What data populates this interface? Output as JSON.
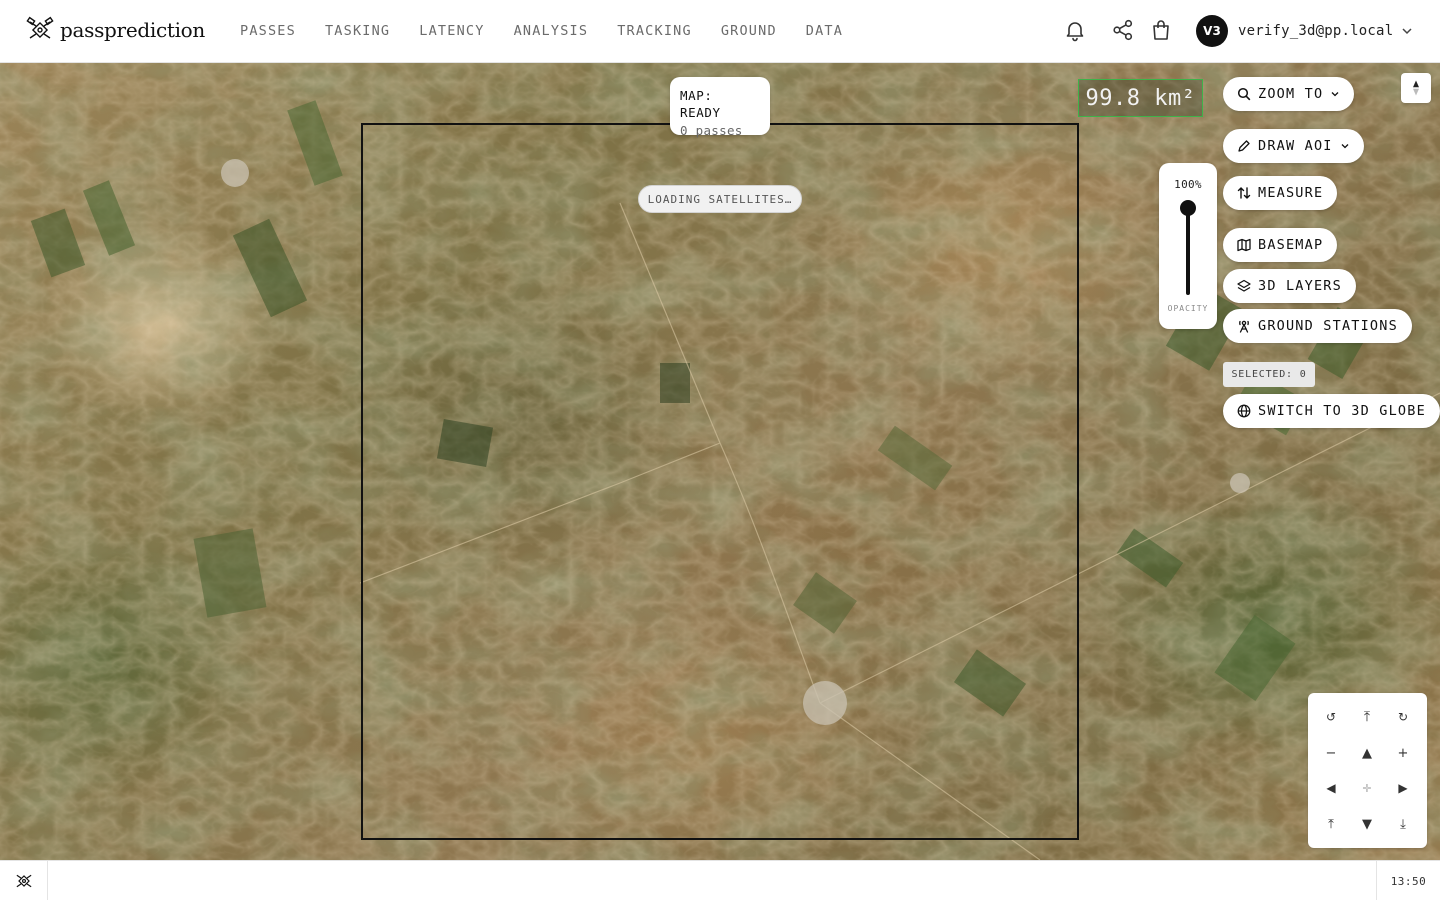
{
  "app": {
    "name": "passprediction",
    "logo_icon": "satellite-logo-icon"
  },
  "header": {
    "nav": [
      {
        "label": "PASSES"
      },
      {
        "label": "TASKING"
      },
      {
        "label": "LATENCY"
      },
      {
        "label": "ANALYSIS"
      },
      {
        "label": "TRACKING"
      },
      {
        "label": "GROUND"
      },
      {
        "label": "DATA"
      }
    ],
    "icons": [
      "bell-icon",
      "share-icon",
      "shopping-bag-icon"
    ],
    "user": {
      "initials": "V3",
      "email": "verify_3d@pp.local"
    }
  },
  "map": {
    "status": {
      "title": "MAP: READY",
      "subtitle": "0 passes"
    },
    "loading_text": "LOADING SATELLITES…",
    "area_readout": "99.8 km²",
    "opacity": {
      "value_label": "100%",
      "value": 1.0,
      "label": "OPACITY"
    },
    "controls": {
      "zoom_to": "ZOOM TO",
      "draw_aoi": "DRAW AOI",
      "measure": "MEASURE",
      "basemap": "BASEMAP",
      "layers_3d": "3D LAYERS",
      "ground_stations": "GROUND STATIONS",
      "selected": "SELECTED: 0",
      "switch_globe": "SWITCH TO 3D GLOBE"
    },
    "nav_pad": {
      "rotate_left": "↺",
      "tilt_up": "⤒",
      "rotate_right": "↻",
      "zoom_out": "−",
      "pan_up": "▲",
      "zoom_in": "+",
      "pan_left": "◀",
      "center": "✛",
      "pan_right": "▶",
      "pitch_up": "⤒",
      "pan_down": "▼",
      "pitch_down": "⤓"
    },
    "accent_color": "#3fb24a"
  },
  "footer": {
    "time": "13:50"
  }
}
